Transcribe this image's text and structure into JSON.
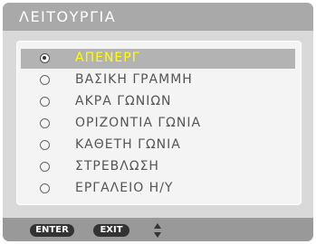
{
  "menu": {
    "title": "ΛΕΙΤΟΥΡΓΙΑ",
    "options": [
      {
        "label": "ΑΠΕΝΕΡΓ",
        "selected": true
      },
      {
        "label": "ΒΑΣΙΚΗ ΓΡΑΜΜΗ",
        "selected": false
      },
      {
        "label": "ΑΚΡΑ ΓΩΝΙΩΝ",
        "selected": false
      },
      {
        "label": "ΟΡΙΖΟΝΤΙΑ ΓΩΝΙΑ",
        "selected": false
      },
      {
        "label": "ΚΑΘΕΤΗ ΓΩΝΙΑ",
        "selected": false
      },
      {
        "label": "ΣΤΡΕΒΛΩΣΗ",
        "selected": false
      },
      {
        "label": "ΕΡΓΑΛΕΙΟ Η/Υ",
        "selected": false
      }
    ]
  },
  "footer": {
    "enter_label": "ENTER",
    "exit_label": "EXIT",
    "nav_icon": "up-down-arrows-icon"
  },
  "colors": {
    "frame": "#d9d9d9",
    "title_bar": "#a9a9a9",
    "panel": "#f4f4f4",
    "selected_row": "#b3b3b3",
    "selected_text": "#ffff00",
    "footer": "#999999"
  }
}
